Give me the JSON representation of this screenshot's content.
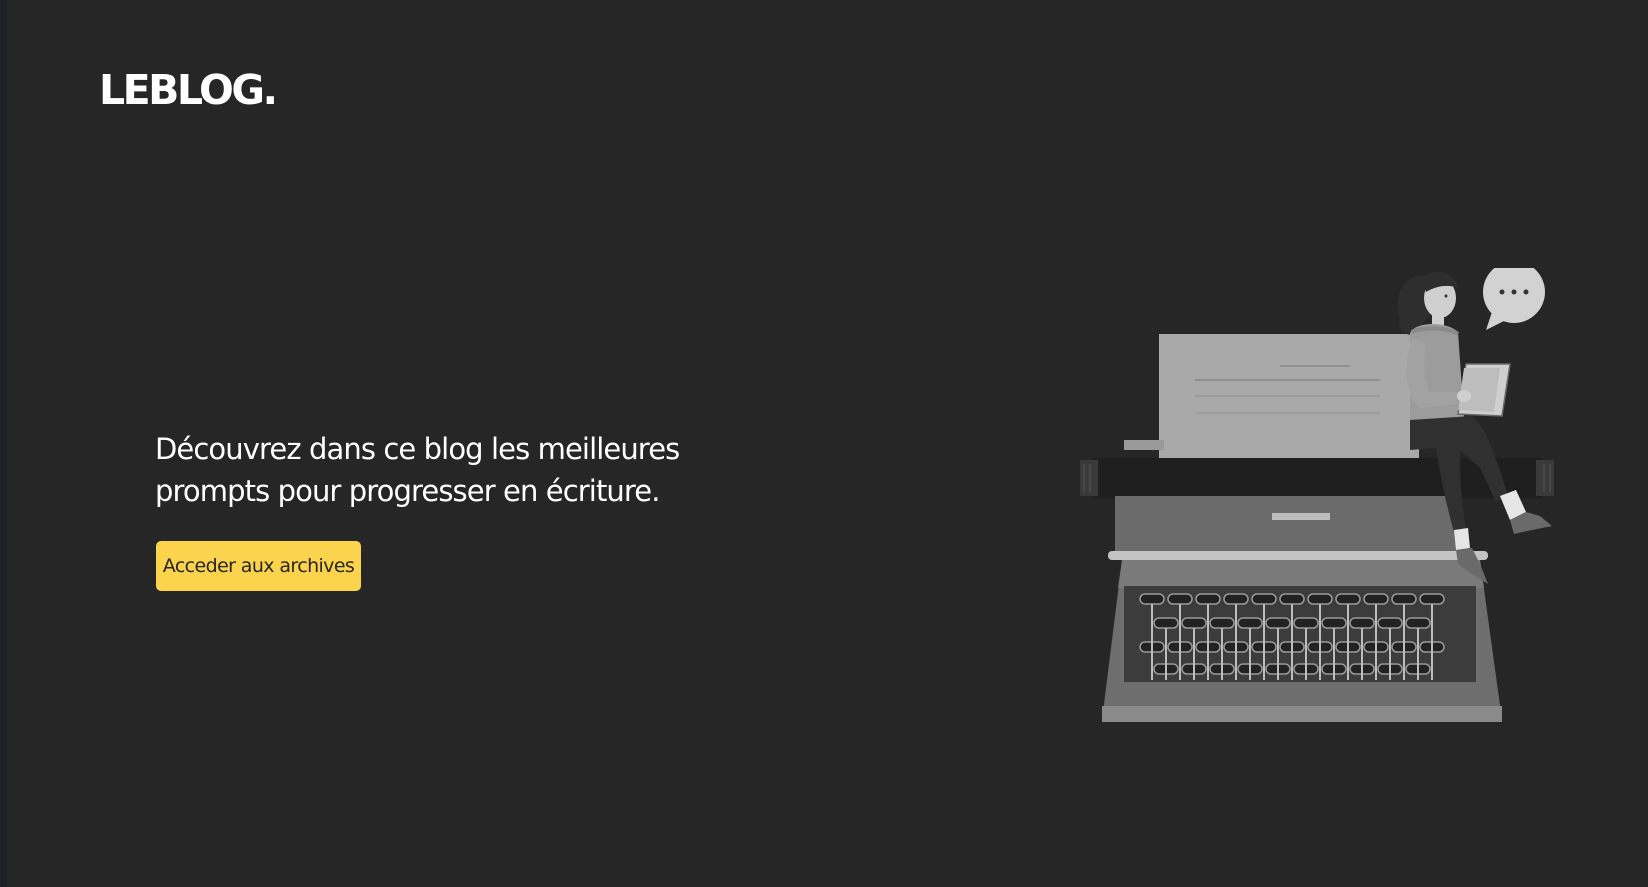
{
  "header": {
    "logo": "LEBLOG."
  },
  "hero": {
    "text": "Découvrez dans ce blog les meilleures prompts pour progresser en écriture.",
    "cta_label": "Acceder aux archives"
  },
  "illustration": {
    "subject": "woman-sitting-on-typewriter-reading",
    "speech_bubble_text": "•••"
  },
  "colors": {
    "background": "#262626",
    "text": "#ffffff",
    "accent": "#fcd34d",
    "button_text": "#262626"
  }
}
